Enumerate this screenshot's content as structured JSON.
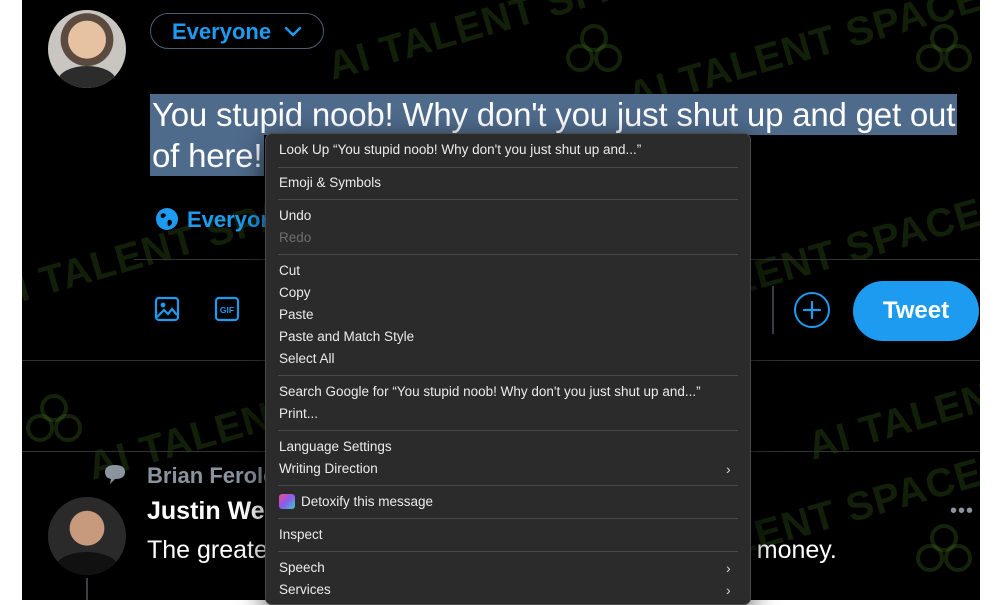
{
  "composer": {
    "audience_label": "Everyone",
    "tweet_text": "You stupid noob! Why don't you just shut up and get out of here!",
    "reply_setting_label": "Everyone",
    "tweet_button_label": "Tweet"
  },
  "timeline_tweet": {
    "context_author": "Brian Ferolo",
    "author": "Justin Wel",
    "body_start": "The greate",
    "body_end": "ng money."
  },
  "watermark": "AI TALENT SPACE",
  "context_menu": {
    "items": [
      {
        "label": "Look Up “You stupid noob! Why don't you just shut up and...”"
      },
      {
        "label": "Emoji & Symbols"
      },
      {
        "label": "Undo"
      },
      {
        "label": "Redo",
        "disabled": true
      },
      {
        "label": "Cut"
      },
      {
        "label": "Copy"
      },
      {
        "label": "Paste"
      },
      {
        "label": "Paste and Match Style"
      },
      {
        "label": "Select All"
      },
      {
        "label": "Search Google for “You stupid noob! Why don't you just shut up and...”"
      },
      {
        "label": "Print..."
      },
      {
        "label": "Language Settings"
      },
      {
        "label": "Writing Direction",
        "submenu": true
      },
      {
        "label": "Detoxify this message"
      },
      {
        "label": "Inspect"
      },
      {
        "label": "Speech",
        "submenu": true
      },
      {
        "label": "Services",
        "submenu": true
      }
    ]
  },
  "colors": {
    "accent": "#1d9bf0",
    "selection": "#4f6b8c",
    "menu_bg": "#2b2b2b",
    "background": "#000000"
  }
}
